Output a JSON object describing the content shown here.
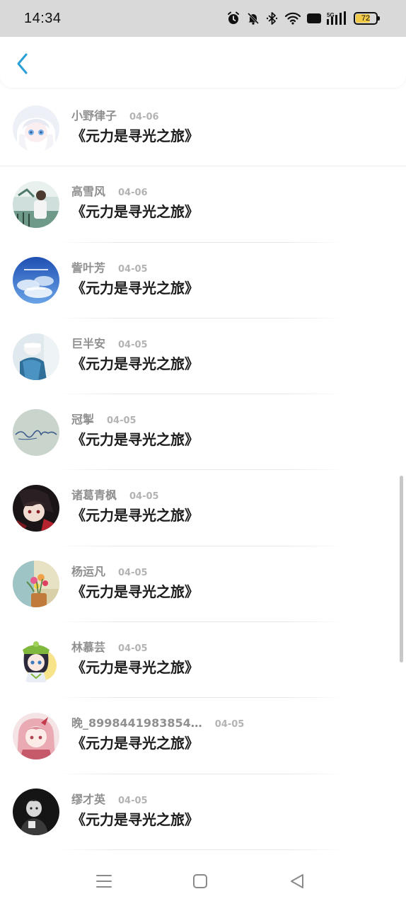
{
  "status_bar": {
    "time": "14:34",
    "icons": [
      "alarm-icon",
      "bell-muted-icon",
      "bluetooth-icon",
      "wifi-icon",
      "hd-icon",
      "signal-5g-icon",
      "battery-icon"
    ],
    "hd_label": "HD",
    "network_label": "5G",
    "battery_level": "72",
    "battery_fraction": 0.72,
    "battery_color": "#f0c946"
  },
  "header": {
    "back_icon": "chevron-left-icon",
    "accent_color": "#2a9fd6"
  },
  "list": {
    "items": [
      {
        "username": "小野律子",
        "date": "04-06",
        "book": "《元力是寻光之旅》",
        "avatar": "anime-girl-white-hair"
      },
      {
        "username": "高雪风",
        "date": "04-06",
        "book": "《元力是寻光之旅》",
        "avatar": "man-outdoor-photo"
      },
      {
        "username": "訾叶芳",
        "date": "04-05",
        "book": "《元力是寻光之旅》",
        "avatar": "blue-sky-clouds"
      },
      {
        "username": "巨半安",
        "date": "04-05",
        "book": "《元力是寻光之旅》",
        "avatar": "person-blue-shirt"
      },
      {
        "username": "冠掣",
        "date": "04-05",
        "book": "《元力是寻光之旅》",
        "avatar": "handwriting-sketch"
      },
      {
        "username": "诸葛青枫",
        "date": "04-05",
        "book": "《元力是寻光之旅》",
        "avatar": "anime-dark-red"
      },
      {
        "username": "杨运凡",
        "date": "04-05",
        "book": "《元力是寻光之旅》",
        "avatar": "flowers-window"
      },
      {
        "username": "林慕芸",
        "date": "04-05",
        "book": "《元力是寻光之旅》",
        "avatar": "anime-green-hat"
      },
      {
        "username": "晚_8998441983854…",
        "date": "04-05",
        "book": "《元力是寻光之旅》",
        "avatar": "anime-pink-hair"
      },
      {
        "username": "缪才英",
        "date": "04-05",
        "book": "《元力是寻光之旅》",
        "avatar": "dark-portrait"
      }
    ]
  },
  "nav_bar": {
    "buttons": [
      "menu-icon",
      "home-square-icon",
      "back-triangle-icon"
    ]
  }
}
